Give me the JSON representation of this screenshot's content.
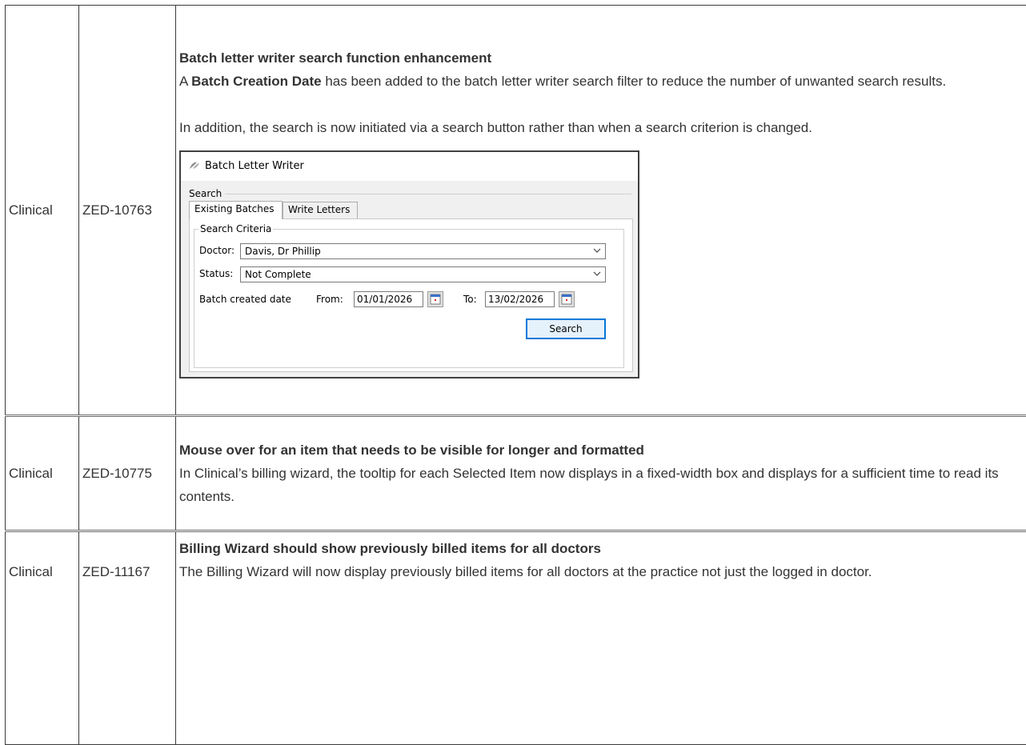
{
  "rows": [
    {
      "area": "Clinical",
      "id": "ZED-10763",
      "title": "Batch letter writer search function enhancement",
      "para1_pre": "A ",
      "para1_bold": "Batch Creation Date",
      "para1_post": " has been added to the batch letter writer search filter to reduce the number of unwanted search results.",
      "para2": "In addition, the search is now initiated via a search button rather than when a search criterion is changed."
    },
    {
      "area": "Clinical",
      "id": "ZED-10775",
      "title": "Mouse over for an item that needs to be visible for longer and formatted",
      "body": "In Clinical’s billing wizard, the tooltip for each Selected Item now displays in a fixed-width box and displays for a sufficient time to read its contents."
    },
    {
      "area": "Clinical",
      "id": "ZED-11167",
      "title": "Billing Wizard should show previously billed items for all doctors",
      "body": "The Billing Wizard will now display previously billed items for all doctors at the practice not just the logged in doctor."
    }
  ],
  "dialog": {
    "title": "Batch Letter Writer",
    "section": "Search",
    "tabs": [
      "Existing Batches",
      "Write Letters"
    ],
    "group": "Search Criteria",
    "doctor_label": "Doctor:",
    "doctor_value": "Davis, Dr Phillip",
    "status_label": "Status:",
    "status_value": "Not Complete",
    "date_label": "Batch created date",
    "from_label": "From:",
    "from_value": "01/01/2026",
    "to_label": "To:",
    "to_value": "13/02/2026",
    "search_button": "Search",
    "icons": [
      "app-logo-icon",
      "chevron-down-icon",
      "calendar-icon"
    ]
  }
}
